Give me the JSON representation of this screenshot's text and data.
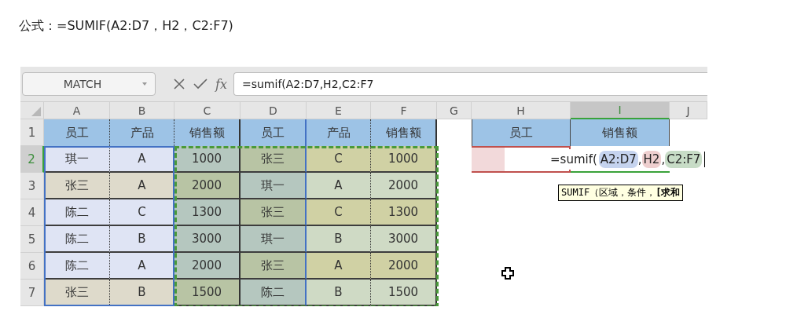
{
  "caption": "公式：=SUMIF(A2:D7，H2，C2:F7)",
  "name_box": {
    "value": "MATCH"
  },
  "formula_bar": {
    "function_label": "fx",
    "value": "=sumif(A2:D7,H2,C2:F7"
  },
  "columns": [
    {
      "label": "A",
      "selected": false
    },
    {
      "label": "B",
      "selected": false
    },
    {
      "label": "C",
      "selected": false
    },
    {
      "label": "D",
      "selected": false
    },
    {
      "label": "E",
      "selected": false
    },
    {
      "label": "F",
      "selected": false
    },
    {
      "label": "G",
      "selected": false
    },
    {
      "label": "H",
      "selected": false
    },
    {
      "label": "I",
      "selected": true
    },
    {
      "label": "J",
      "selected": false
    }
  ],
  "rows": [
    {
      "label": "1",
      "selected": false,
      "cells": [
        {
          "text": "员工",
          "color": "#9dc3e6"
        },
        {
          "text": "产品",
          "color": "#9dc3e6"
        },
        {
          "text": "销售额",
          "color": "#9dc3e6"
        },
        {
          "text": "员工",
          "color": "#9dc3e6"
        },
        {
          "text": "产品",
          "color": "#9dc3e6"
        },
        {
          "text": "销售额",
          "color": "#9dc3e6"
        }
      ]
    },
    {
      "label": "2",
      "selected": true,
      "cells": [
        {
          "text": "琪一",
          "color": "#dfe4f4"
        },
        {
          "text": "A",
          "color": "#dfe4f4"
        },
        {
          "text": "1000",
          "color": "#b5c7bf"
        },
        {
          "text": "张三",
          "color": "#b8c4a4"
        },
        {
          "text": "C",
          "color": "#d0d1a4"
        },
        {
          "text": "1000",
          "color": "#d0d1a4"
        }
      ]
    },
    {
      "label": "3",
      "selected": false,
      "cells": [
        {
          "text": "张三",
          "color": "#dedacb"
        },
        {
          "text": "A",
          "color": "#dedacb"
        },
        {
          "text": "2000",
          "color": "#b8c4a4"
        },
        {
          "text": "琪一",
          "color": "#b5c7bf"
        },
        {
          "text": "A",
          "color": "#cfdac5"
        },
        {
          "text": "2000",
          "color": "#cfdac5"
        }
      ]
    },
    {
      "label": "4",
      "selected": false,
      "cells": [
        {
          "text": "陈二",
          "color": "#dfe4f4"
        },
        {
          "text": "C",
          "color": "#dfe4f4"
        },
        {
          "text": "1300",
          "color": "#b5c7bf"
        },
        {
          "text": "张三",
          "color": "#b8c4a4"
        },
        {
          "text": "C",
          "color": "#d0d1a4"
        },
        {
          "text": "1300",
          "color": "#d0d1a4"
        }
      ]
    },
    {
      "label": "5",
      "selected": false,
      "cells": [
        {
          "text": "陈二",
          "color": "#dfe4f4"
        },
        {
          "text": "B",
          "color": "#dfe4f4"
        },
        {
          "text": "3000",
          "color": "#b5c7bf"
        },
        {
          "text": "琪一",
          "color": "#b5c7bf"
        },
        {
          "text": "B",
          "color": "#cfdac5"
        },
        {
          "text": "3000",
          "color": "#cfdac5"
        }
      ]
    },
    {
      "label": "6",
      "selected": false,
      "cells": [
        {
          "text": "陈二",
          "color": "#dfe4f4"
        },
        {
          "text": "A",
          "color": "#dfe4f4"
        },
        {
          "text": "2000",
          "color": "#b5c7bf"
        },
        {
          "text": "张三",
          "color": "#b8c4a4"
        },
        {
          "text": "A",
          "color": "#d0d1a4"
        },
        {
          "text": "2000",
          "color": "#d0d1a4"
        }
      ]
    },
    {
      "label": "7",
      "selected": false,
      "cells": [
        {
          "text": "张三",
          "color": "#dedacb"
        },
        {
          "text": "B",
          "color": "#dedacb"
        },
        {
          "text": "1500",
          "color": "#b8c4a4"
        },
        {
          "text": "陈二",
          "color": "#b5c7bf"
        },
        {
          "text": "B",
          "color": "#cfdac5"
        },
        {
          "text": "1500",
          "color": "#cfdac5"
        }
      ]
    }
  ],
  "lookup": {
    "headers": [
      "员工",
      "销售额"
    ],
    "edit_cell": {
      "segments": [
        {
          "text": "=sumif("
        },
        {
          "text": "A2:D7",
          "color": "#c5d3ee",
          "separator": ","
        },
        {
          "text": "H2",
          "color": "#eecfcf",
          "separator": ","
        },
        {
          "text": "C2:F7",
          "color": "#c7dcc6"
        }
      ]
    }
  },
  "tooltip": "SUMIF（区域，条件，**[求和**"
}
